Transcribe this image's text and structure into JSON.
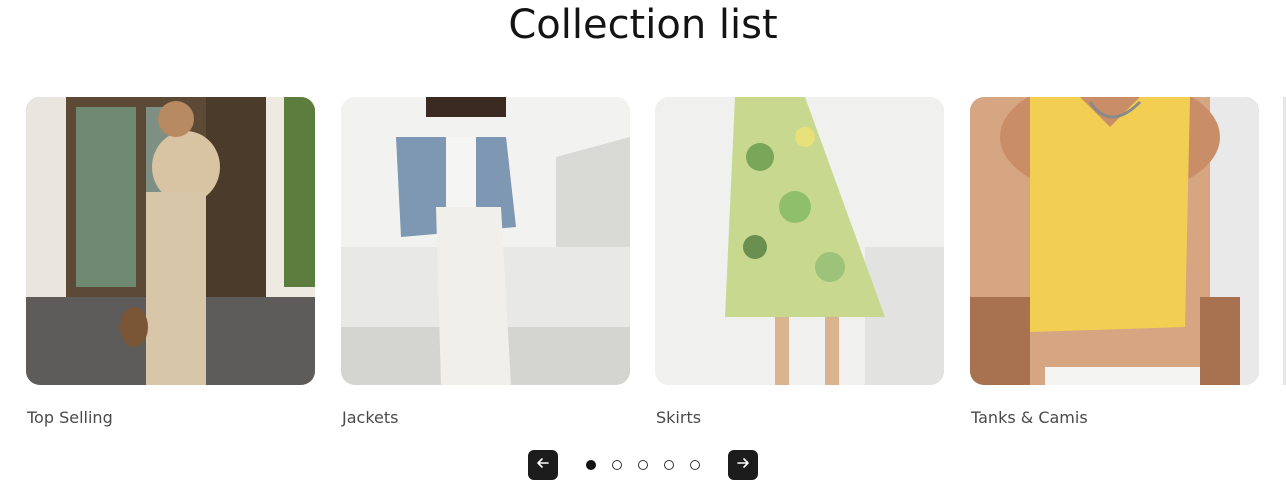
{
  "section": {
    "title": "Collection list"
  },
  "collections": [
    {
      "label": "Top Selling",
      "image": "woman-beige-linen-set-photo"
    },
    {
      "label": "Jackets",
      "image": "woman-tweed-jacket-white-pants-photo"
    },
    {
      "label": "Skirts",
      "image": "green-floral-midi-skirt-photo"
    },
    {
      "label": "Tanks & Camis",
      "image": "yellow-knit-tank-top-photo"
    }
  ],
  "pagination": {
    "prev_icon": "arrow-left-icon",
    "next_icon": "arrow-right-icon",
    "dot_count": 5,
    "active_index": 0
  },
  "colors": {
    "button_bg": "#1c1c1c",
    "title": "#141414",
    "label": "#4a4a4a"
  }
}
